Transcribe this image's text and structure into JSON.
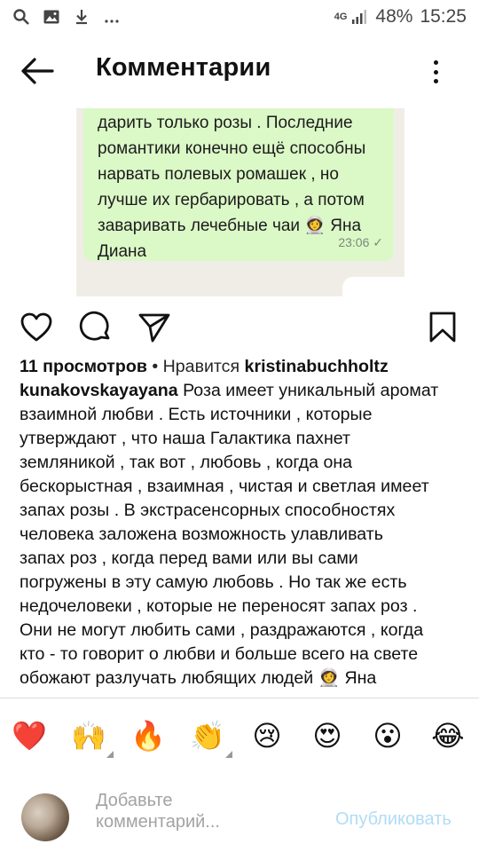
{
  "status_bar": {
    "network": "4G",
    "battery": "48%",
    "time": "15:25",
    "icons": [
      "search-icon",
      "image-icon",
      "download-icon",
      "more-notifications-icon",
      "signal-icon"
    ]
  },
  "header": {
    "title": "Комментарии",
    "icons": [
      "back-arrow-icon",
      "more-vertical-icon"
    ]
  },
  "media": {
    "message_text": "дарить только розы . Последние\nромантики конечно ещё способны\nнарвать полевых ромашек , но\nлучше их гербарировать , а потом\nзаваривать лечебные чаи 👩‍🚀 Яна\nДиана",
    "message_time": "23:06 ✓",
    "mute_icon": "muted-speaker-icon",
    "colors": {
      "bubble": "#dbf8c7",
      "chat_bg": "#f0ede6",
      "fab": "#00a884"
    }
  },
  "actions": {
    "icons": [
      "heart-icon",
      "comment-icon",
      "send-icon",
      "bookmark-icon"
    ]
  },
  "caption": {
    "views": "11 просмотров",
    "likes_prefix": "• Нравится",
    "liker": "kristinabuchholtz",
    "author": "kunakovskayayana",
    "text": "Роза имеет уникальный аромат\nвзаимной любви . Есть источники , которые\nутверждают , что наша Галактика пахнет\nземляникой , так вот , любовь , когда она\nбескорыстная , взаимная , чистая и светлая имеет\nзапах  розы . В экстрасенсорных способностях\nчеловека заложена возможность улавливать\nзапах роз , когда перед вами или вы сами\nпогружены в эту самую любовь . Но так же есть\nнедочеловеки , которые не переносят запах роз .\nОни не могут любить сами , раздражаются , когда\nкто - то говорит о любви и больше всего на свете\nобожают разлучать любящих людей 👩‍🚀 Яна"
  },
  "emoji_bar": {
    "emojis": [
      "❤️",
      "🙌",
      "🔥",
      "👏",
      "😢",
      "😍",
      "😮",
      "😂"
    ]
  },
  "comment_box": {
    "placeholder": "Добавьте\nкомментарий...",
    "publish_label": "Опубликовать",
    "publish_color": "#b2dbf7"
  }
}
